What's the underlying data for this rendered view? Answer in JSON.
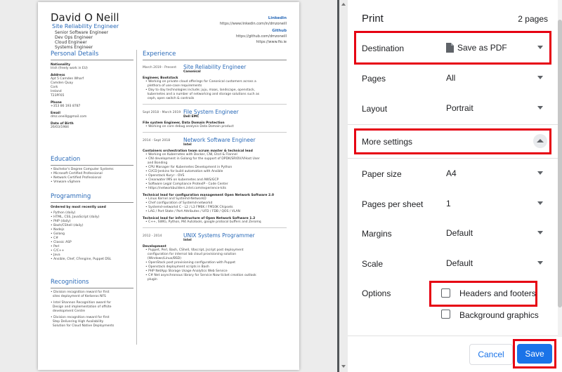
{
  "resume": {
    "name": "David O Neill",
    "title": "Site Reliability Engineer",
    "subtitles": [
      "Senior Software Engineer",
      "Dev Ops Engineer",
      "Cloud Engineer",
      "Systems Engineer"
    ],
    "links": [
      {
        "heading": "Linkedin",
        "url": "https://www.linkedin.com/in/dmzoneill"
      },
      {
        "heading": "Github",
        "url": "https://github.com/dmzoneill"
      },
      {
        "heading": "",
        "url": "https://www.fio.ie"
      }
    ],
    "personal_heading": "Personal Details",
    "personal": [
      {
        "label": "Nationality",
        "lines": [
          "Irish (freely work in EU)"
        ]
      },
      {
        "label": "Address",
        "lines": [
          "Apt 5 Camden Wharf",
          "Camden Quay",
          "Cork",
          "Ireland",
          "T23PF65"
        ]
      },
      {
        "label": "Phone",
        "lines": [
          "+353 86 193 8787"
        ]
      },
      {
        "label": "Email",
        "lines": [
          "dmz.oneill@gmail.com"
        ]
      },
      {
        "label": "Date of Birth",
        "lines": [
          "26/03/1984"
        ]
      }
    ],
    "education_heading": "Education",
    "education": [
      "Bachelor's Degree Computer Systems",
      "Microsoft Certified Professional",
      "Network Certified Professional",
      "Vmware vSphere"
    ],
    "programming_heading": "Programming",
    "programming_sub": "Ordered by most recently used",
    "programming": [
      "Python (daily)",
      "HTML, CSS, JavaScript (daily)",
      "PHP (daily)",
      "Bash/CShell (daily)",
      "Nodejs",
      "Golang",
      "C#",
      "Classic ASP",
      "Perl",
      "C/C++",
      "Java",
      "Ansible, Chef, CFengine, Puppet DSL"
    ],
    "recognitions_heading": "Recognitions",
    "recognitions": [
      [
        "Division recognition reward for first",
        "sites deployment of Kerberos NFS"
      ],
      [
        "Intel Shannon Recognition award for",
        "Design and implementation of offsite",
        "development Centre"
      ],
      [
        "Division recognition reward for first",
        "Step Delivering High Availability",
        "Solution for Cloud Native Deployments"
      ]
    ],
    "experience_heading": "Experience",
    "jobs": [
      {
        "date": "March 2019 - Present",
        "title": "Site Reliability Engineer",
        "company": "Canonical",
        "sections": [
          {
            "heading": "Engineer, Bootstack",
            "bullets": [
              "Working on private cloud offerings for Canonical customers across a",
              "plethora of use-case requirements",
              "Day to day technologies include; juju, maas, landscape, openstack,",
              "kubernetes and a number of networking and storage solutions such as",
              "ceph, open switch & contrails"
            ]
          }
        ]
      },
      {
        "date": "Sept 2018 - March 2019",
        "title": "File System Engineer",
        "company": "Dell EMC",
        "sections": [
          {
            "heading": "File system Engineer, Data Domain Protection",
            "bullets": [
              "Working on core debug analysis Data Domain product"
            ]
          }
        ]
      },
      {
        "date": "2014 - Sept 2018",
        "title": "Network Software Engineer",
        "company": "Intel",
        "sections": [
          {
            "heading": "Containers orchestration team scrum master & technical lead",
            "bullets": [
              "Working on Kubernetes with Docker, CNI, Etcd & Flannel",
              "CNI development in Golang for the support of DPDK/SRIOV/VHost User",
              "and Bonding",
              "CPU Manager for Kubernetes Development in Python",
              "CI/CD Jenkins for build automation with Ansible",
              "Openstack Kuryr - OVS",
              "Clearwater IMS on kubernetes and AWS/GCP",
              "Software Legal Compliance ProtexIP - Code Center",
              "https://networkbuilders.intel.com/experience-kits"
            ]
          },
          {
            "heading": "Technical lead for configuration management Open Network Software 2.0",
            "bullets": [
              "Linux Kernel and Systemd-NetworkD",
              "Chef configuration of Systemd-networkd",
              "Systemd-networkd C - L2 / L3 FM6K / FM10K Chipsets",
              "LAG / Port State / Port Attributes / UFD / FDB / QOS / VLAN"
            ]
          },
          {
            "heading": "Technical lead for infrastructure of Open Network Software 1.2",
            "bullets": [
              "C++, SWIG, Python, M4 Autotools, google protocol buffers and Zeromq"
            ]
          }
        ]
      },
      {
        "date": "2012 - 2014",
        "title": "UNIX Systems Programmer",
        "company": "Intel",
        "sections": [
          {
            "heading": "Development",
            "bullets": [
              "Puppet, Perl, Bash, CShell, Vbscript, Jscript post deployment",
              "configuration for internal lab cloud provisioning solution",
              "(Windows/Linux/BSD)",
              "OpenStack post provisioning configuration with Puppet",
              "Openstack deployment scripts in Bash",
              "PHP NetApp Storage Usage Analytics Web Service",
              "C# Net asynchronous library for Service Now ticket creation outlook",
              "plugin"
            ]
          }
        ]
      }
    ]
  },
  "print": {
    "title": "Print",
    "page_count": "2 pages",
    "destination": {
      "label": "Destination",
      "value": "Save as PDF"
    },
    "pages": {
      "label": "Pages",
      "value": "All"
    },
    "layout": {
      "label": "Layout",
      "value": "Portrait"
    },
    "more_settings": "More settings",
    "paper_size": {
      "label": "Paper size",
      "value": "A4"
    },
    "pages_per_sheet": {
      "label": "Pages per sheet",
      "value": "1"
    },
    "margins": {
      "label": "Margins",
      "value": "Default"
    },
    "scale": {
      "label": "Scale",
      "value": "Default"
    },
    "options_label": "Options",
    "headers_footers": {
      "label": "Headers and footers",
      "checked": false
    },
    "background_graphics": {
      "label": "Background graphics",
      "checked": false
    },
    "cancel": "Cancel",
    "save": "Save"
  },
  "colors": {
    "accent": "#1a73e8",
    "highlight": "#e60012",
    "resume_blue": "#2a6ab8"
  }
}
